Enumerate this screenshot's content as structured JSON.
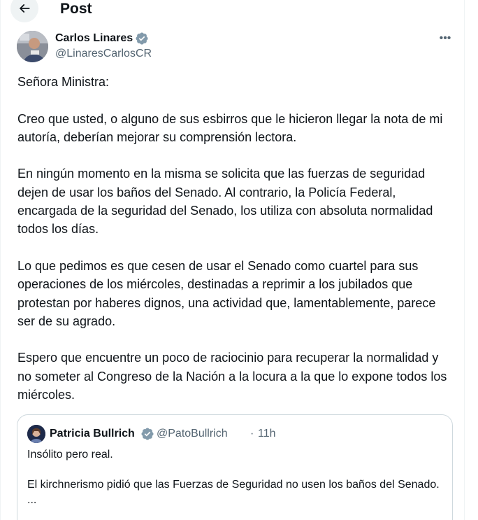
{
  "header": {
    "back_icon": "arrow-left-icon",
    "title": "Post"
  },
  "post": {
    "author_name": "Carlos Linares",
    "author_handle": "@LinaresCarlosCR",
    "verified_icon": "verified-badge-icon",
    "more_icon": "more-horizontal-icon",
    "more_label": "•••",
    "paragraphs": [
      "Señora Ministra:",
      "Creo que usted, o alguno de sus esbirros que le hicieron llegar la nota de mi autoría, deberían mejorar su comprensión lectora.",
      "En ningún momento en la misma se solicita que las fuerzas de seguridad dejen de usar los baños del Senado. Al contrario, la Policía Federal, encargada de la seguridad del Senado, los utiliza con absoluta normalidad todos los días.",
      "Lo que pedimos es que cesen de usar el Senado como cuartel para sus operaciones de los miércoles, destinadas a reprimir a los jubilados que protestan por haberes dignos, una actividad que, lamentablemente, parece ser de su agrado.",
      "Espero que encuentre un poco de raciocinio para recuperar la normalidad y no someter al Congreso de la Nación a la locura a la que lo expone todos los miércoles."
    ]
  },
  "quote": {
    "author_name": "Patricia Bullrich",
    "author_handle": "@PatoBullrich",
    "separator": "·",
    "time": "11h",
    "lines": [
      "Insólito pero real.",
      "El kirchnerismo pidió que las Fuerzas de Seguridad no usen los baños del Senado.",
      "..."
    ]
  },
  "colors": {
    "text": "#0f1419",
    "muted": "#536471",
    "verified": "#829aab",
    "border": "#cfd9de"
  }
}
